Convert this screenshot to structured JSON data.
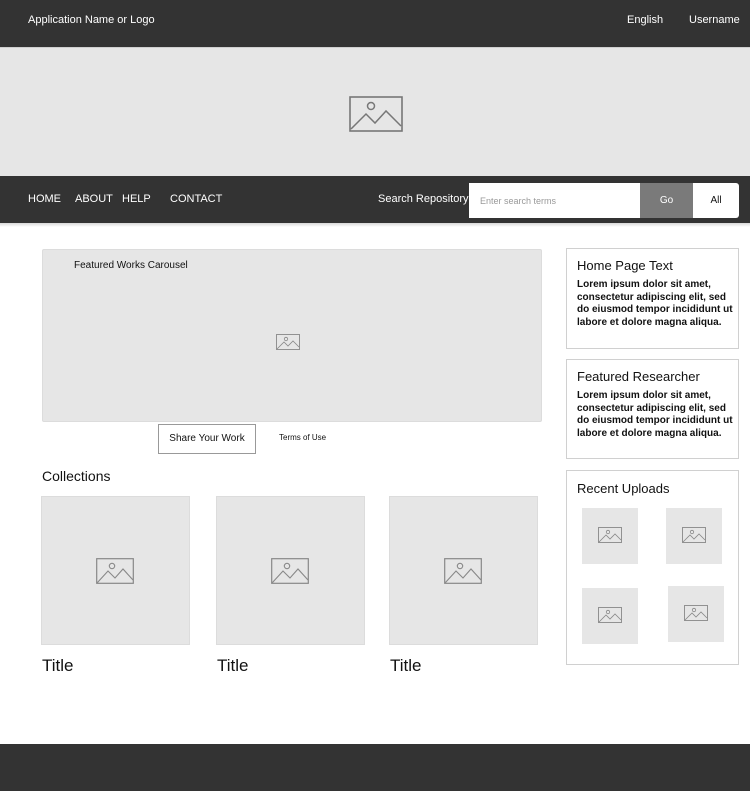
{
  "header": {
    "app_name": "Application Name or Logo",
    "language": "English",
    "username": "Username"
  },
  "hero": {
    "icon": "image-placeholder-icon"
  },
  "nav": {
    "items": [
      "HOME",
      "ABOUT",
      "HELP",
      "CONTACT"
    ],
    "search_label": "Search Repository",
    "search_placeholder": "Enter search terms",
    "go_label": "Go",
    "all_label": "All"
  },
  "carousel": {
    "label": "Featured Works Carousel"
  },
  "actions": {
    "share_label": "Share Your Work",
    "terms_label": "Terms of Use"
  },
  "collections": {
    "heading": "Collections",
    "items": [
      {
        "title": "Title"
      },
      {
        "title": "Title"
      },
      {
        "title": "Title"
      }
    ]
  },
  "sidebar": {
    "home_text": {
      "heading": "Home Page Text",
      "body": "Lorem ipsum dolor sit amet, consectetur adipiscing elit, sed do eiusmod tempor incididunt ut labore et dolore magna aliqua."
    },
    "featured_researcher": {
      "heading": "Featured Researcher",
      "body": "Lorem ipsum dolor sit amet, consectetur adipiscing elit, sed do eiusmod tempor incididunt ut labore et dolore magna aliqua."
    },
    "recent_uploads": {
      "heading": "Recent Uploads"
    }
  },
  "colors": {
    "bar_background": "#333333",
    "placeholder_fill": "#e6e6e6",
    "go_button": "#7a7a7a"
  }
}
